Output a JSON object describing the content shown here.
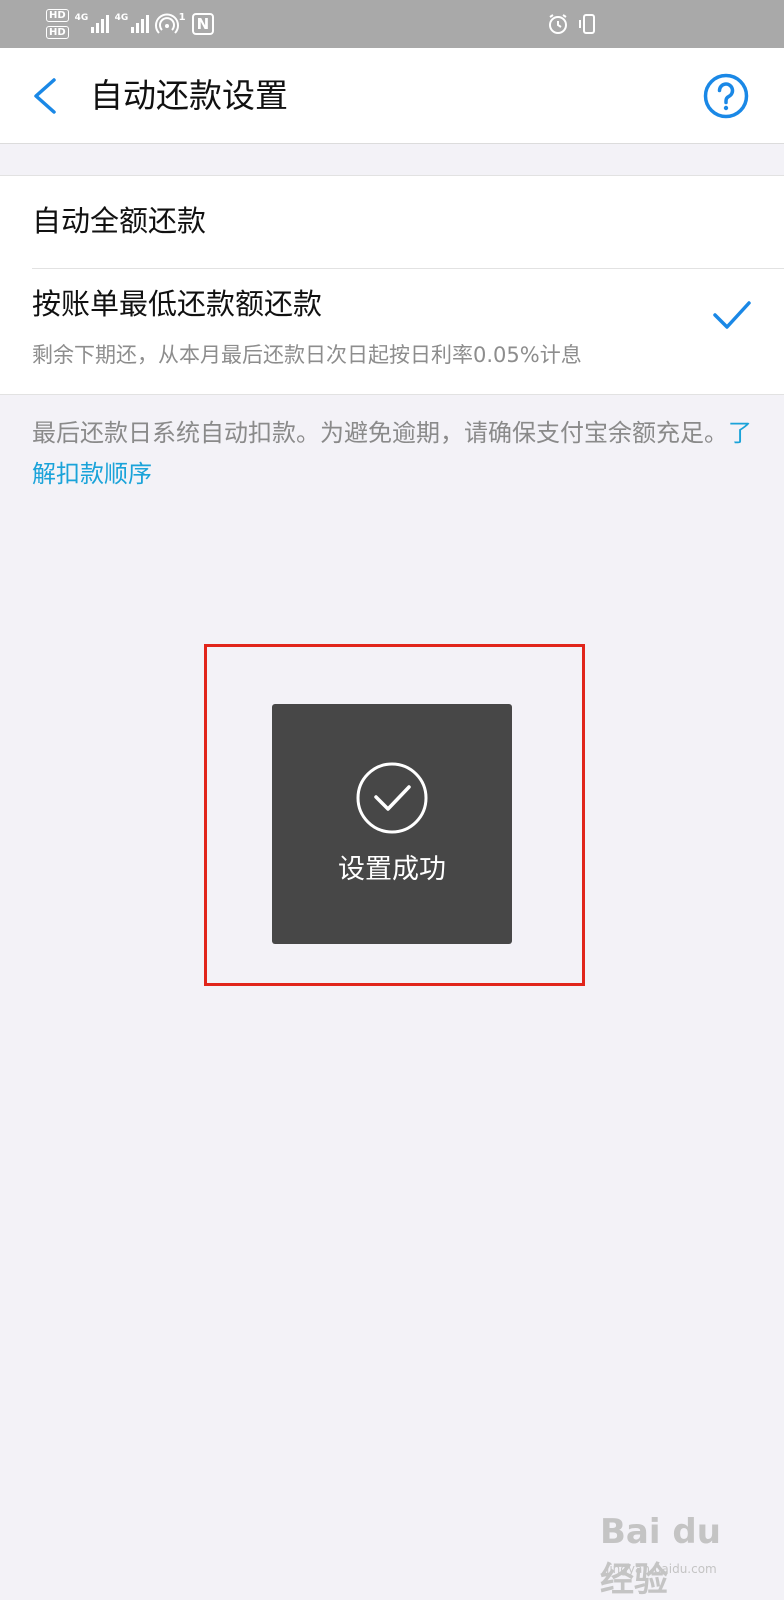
{
  "status_bar": {
    "hd_badges": [
      "HD",
      "HD"
    ],
    "signal_1_label": "4G",
    "signal_2_label": "4G",
    "hotspot_count": "1",
    "nfc_label": "N",
    "icons": [
      "hd-icon",
      "signal-icon",
      "hotspot-icon",
      "nfc-icon",
      "alarm-icon",
      "vibrate-icon"
    ]
  },
  "header": {
    "title": "自动还款设置",
    "back_icon": "chevron-left-icon",
    "help_icon": "question-circle-icon",
    "accent_color": "#1a88e6"
  },
  "options": [
    {
      "label": "自动全额还款",
      "selected": false
    },
    {
      "label": "按账单最低还款额还款",
      "sub": "剩余下期还，从本月最后还款日次日起按日利率0.05%计息",
      "selected": true
    }
  ],
  "note": {
    "text": "最后还款日系统自动扣款。为避免逾期，请确保支付宝余额充足。",
    "link": "了解扣款顺序",
    "link_color": "#1aa3d9"
  },
  "toast": {
    "icon": "check-circle-icon",
    "text": "设置成功",
    "highlight_color": "#e1251b"
  },
  "watermark": {
    "logo": "Bai du 经验",
    "site": "jingyan.baidu.com"
  }
}
